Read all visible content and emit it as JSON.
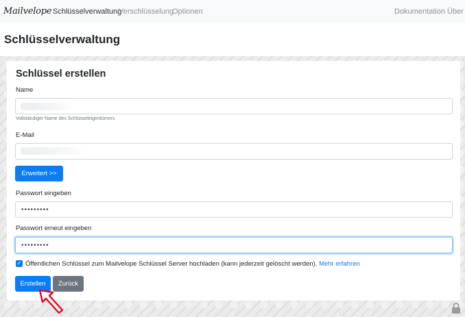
{
  "navbar": {
    "brand": "Mailvelope",
    "items": [
      {
        "label": "Schlüsselverwaltung",
        "active": true
      },
      {
        "label": "Verschlüsselung",
        "active": false
      },
      {
        "label": "Optionen",
        "active": false
      }
    ],
    "right_items": [
      {
        "label": "Dokumentation"
      },
      {
        "label": "Über"
      }
    ]
  },
  "page": {
    "title": "Schlüsselverwaltung"
  },
  "form": {
    "title": "Schlüssel erstellen",
    "name_label": "Name",
    "name_value": "",
    "name_help": "Vollständiger Name des Schlüsseleigentümers",
    "email_label": "E-Mail",
    "email_value": "",
    "advanced_button": "Erweitert >>",
    "password_label": "Passwort eingeben",
    "password_value": "•••••••••",
    "password_confirm_label": "Passwort erneut eingeben",
    "password_confirm_value": "•••••••••",
    "upload_checked": true,
    "upload_text": "Öffentlichen Schlüssel zum Mailvelope Schlüssel Server hochladen (kann jederzeit gelöscht werden).",
    "learn_more_link": "Mehr erfahren",
    "create_button": "Erstellen",
    "back_button": "Zurück"
  },
  "icons": {
    "checkmark": "✓",
    "lock": "lock-icon",
    "pointer_arrow": "arrow-icon"
  },
  "colors": {
    "primary": "#0a7cf4",
    "secondary": "#6c757d",
    "annotation_arrow": "#e8001c"
  }
}
